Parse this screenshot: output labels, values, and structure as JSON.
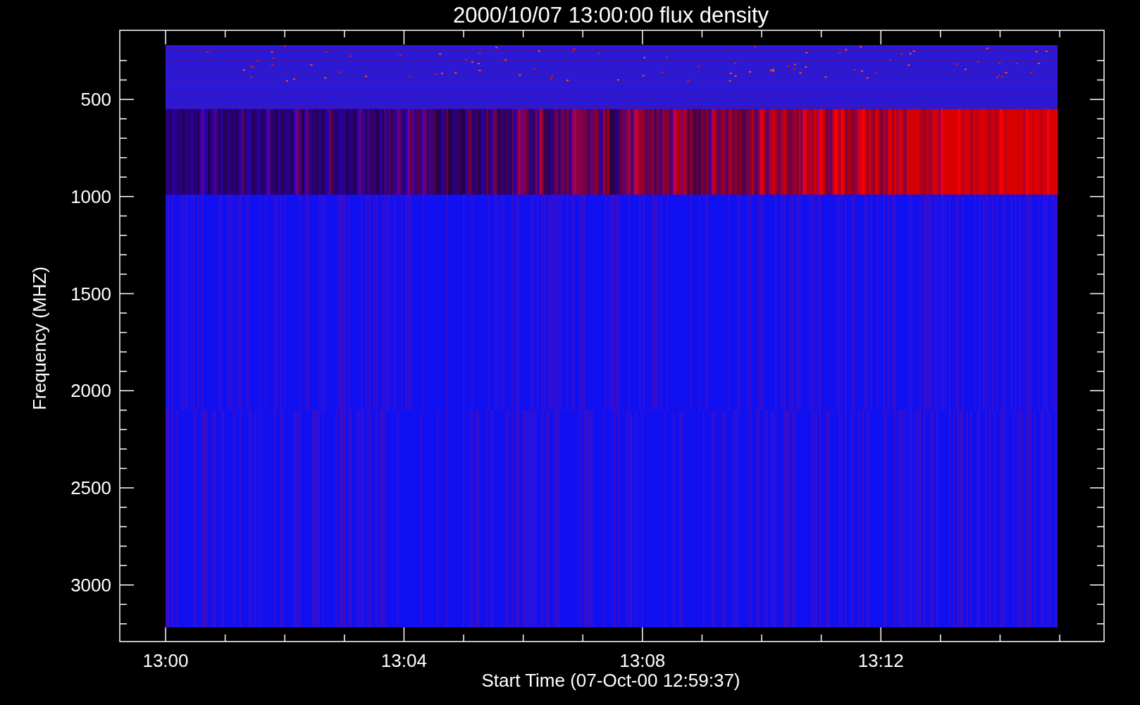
{
  "title": "2000/10/07 13:00:00 flux density",
  "y_axis": {
    "label": "Frequency (MHZ)",
    "ticks": [
      "500",
      "1000",
      "1500",
      "2000",
      "2500",
      "3000"
    ]
  },
  "x_axis": {
    "label": "Start Time (07-Oct-00 12:59:37)",
    "ticks": [
      "13:00",
      "13:04",
      "13:08",
      "13:12"
    ]
  }
}
